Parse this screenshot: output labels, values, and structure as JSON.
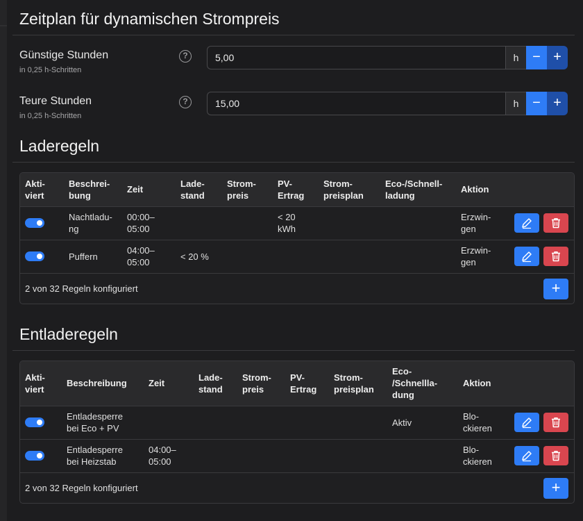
{
  "schedule": {
    "title": "Zeitplan für dynamischen Strompreis",
    "cheap": {
      "label": "Günstige Stunden",
      "hint": "in 0,25 h-Schritten",
      "value": "5,00",
      "unit": "h"
    },
    "expensive": {
      "label": "Teure Stunden",
      "hint": "in 0,25 h-Schritten",
      "value": "15,00",
      "unit": "h"
    },
    "help_glyph": "?",
    "minus_glyph": "−",
    "plus_glyph": "+"
  },
  "charge": {
    "title": "Laderegeln",
    "headers": [
      "Akti-\nviert",
      "Beschrei-\nbung",
      "Zeit",
      "Lade-\nstand",
      "Strom-\npreis",
      "PV-\nErtrag",
      "Strom-\npreisplan",
      "Eco-/Schnell-\nladung",
      "Aktion"
    ],
    "rows": [
      {
        "active": true,
        "desc": "Nachtladu-\nng",
        "time": "00:00–\n05:00",
        "soc": "",
        "price": "",
        "pv": "< 20\nkWh",
        "plan": "",
        "eco": "",
        "action": "Erzwin-\ngen"
      },
      {
        "active": true,
        "desc": "Puffern",
        "time": "04:00–\n05:00",
        "soc": "< 20 %",
        "price": "",
        "pv": "",
        "plan": "",
        "eco": "",
        "action": "Erzwin-\ngen"
      }
    ],
    "footer": "2 von 32 Regeln konfiguriert"
  },
  "discharge": {
    "title": "Entladeregeln",
    "headers": [
      "Akti-\nviert",
      "Beschreibung",
      "Zeit",
      "Lade-\nstand",
      "Strom-\npreis",
      "PV-\nErtrag",
      "Strom-\npreisplan",
      "Eco-\n/Schnellla-\ndung",
      "Aktion"
    ],
    "rows": [
      {
        "active": true,
        "desc": "Entladesperre\nbei Eco + PV",
        "time": "",
        "soc": "",
        "price": "",
        "pv": "",
        "plan": "",
        "eco": "Aktiv",
        "action": "Blo-\nckieren"
      },
      {
        "active": true,
        "desc": "Entladesperre\nbei Heizstab",
        "time": "04:00–\n05:00",
        "soc": "",
        "price": "",
        "pv": "",
        "plan": "",
        "eco": "",
        "action": "Blo-\nckieren"
      }
    ],
    "footer": "2 von 32 Regeln konfiguriert"
  },
  "colors": {
    "accent": "#2e7cf6",
    "danger": "#d9464f",
    "background": "#1d1d1f"
  },
  "icons": {
    "edit": "pencil-icon",
    "delete": "trash-icon",
    "add": "plus-icon",
    "help": "question-circle-icon"
  }
}
